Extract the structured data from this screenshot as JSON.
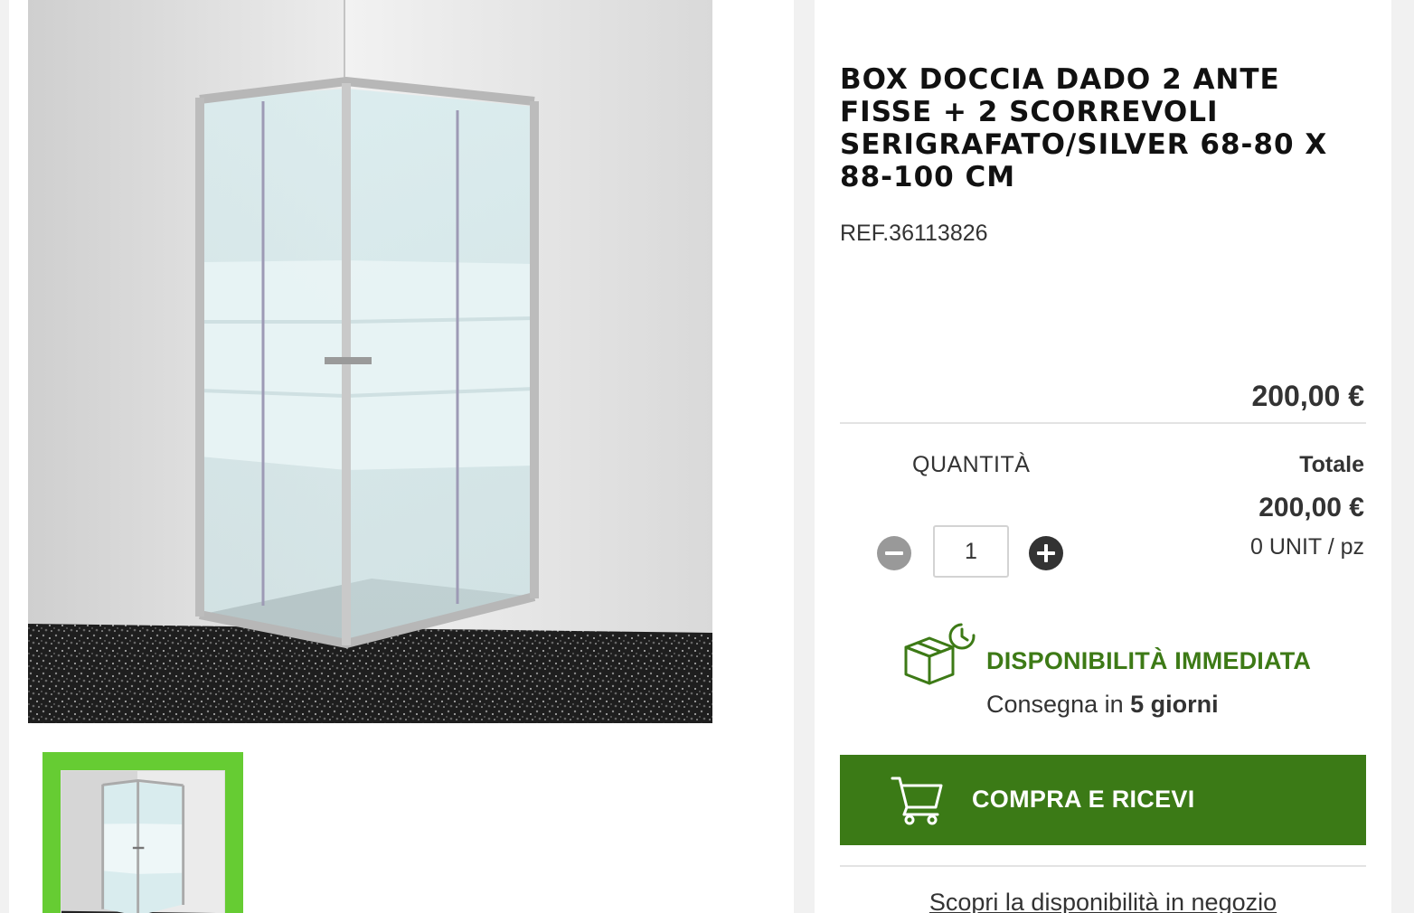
{
  "product": {
    "title": "BOX DOCCIA DADO 2 ANTE FISSE + 2 SCORREVOLI SERIGRAFATO/SILVER 68-80 X 88-100 CM",
    "ref": "REF.36113826",
    "price": "200,00 €"
  },
  "quantity": {
    "label": "QUANTITÀ",
    "value": "1"
  },
  "total": {
    "label": "Totale",
    "value": "200,00 €",
    "unit": "0 UNIT / pz"
  },
  "availability": {
    "title": "DISPONIBILITÀ IMMEDIATA",
    "delivery_prefix": "Consegna in ",
    "delivery_days": "5 giorni",
    "icon": "box-clock-icon",
    "color": "#3d7a16"
  },
  "buy": {
    "label": "COMPRA E RICEVI",
    "icon": "cart-icon",
    "color": "#3b7a16"
  },
  "store_link": "Scopri la disponibilità in negozio",
  "gallery": {
    "selected_border_color": "#66cc33"
  }
}
